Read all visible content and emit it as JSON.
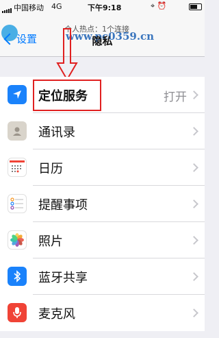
{
  "status_bar": {
    "carrier": "中国移动",
    "network": "4G",
    "time": "下午9:18",
    "hotspot": "个人热点：1个连接"
  },
  "nav": {
    "back_label": "设置",
    "title": "隐私",
    "watermark": "www.pc0359.cn"
  },
  "rows": [
    {
      "label": "定位服务",
      "value": "打开",
      "icon": "location-arrow-icon",
      "color": "#1a82fb"
    },
    {
      "label": "通讯录",
      "value": "",
      "icon": "contacts-icon",
      "color": "#c9c2b6"
    },
    {
      "label": "日历",
      "value": "",
      "icon": "calendar-icon",
      "color": "#ffffff"
    },
    {
      "label": "提醒事项",
      "value": "",
      "icon": "reminders-icon",
      "color": "#ffffff"
    },
    {
      "label": "照片",
      "value": "",
      "icon": "photos-icon",
      "color": "#ffffff"
    },
    {
      "label": "蓝牙共享",
      "value": "",
      "icon": "bluetooth-icon",
      "color": "#1a82fb"
    },
    {
      "label": "麦克风",
      "value": "",
      "icon": "microphone-icon",
      "color": "#f04336"
    }
  ],
  "colors": {
    "accent": "#007aff",
    "highlight": "#e02020"
  }
}
